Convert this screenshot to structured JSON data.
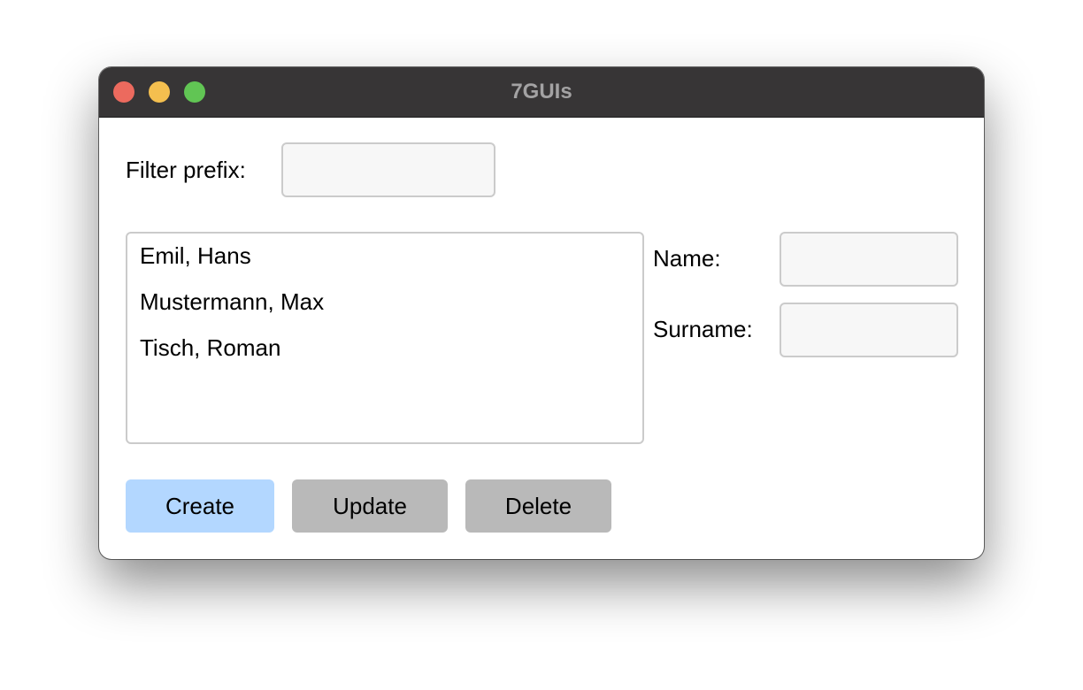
{
  "window": {
    "title": "7GUIs"
  },
  "filter": {
    "label": "Filter prefix:",
    "value": ""
  },
  "list": {
    "items": [
      "Emil, Hans",
      "Mustermann, Max",
      "Tisch, Roman"
    ]
  },
  "form": {
    "name_label": "Name:",
    "name_value": "",
    "surname_label": "Surname:",
    "surname_value": ""
  },
  "buttons": {
    "create_label": "Create",
    "update_label": "Update",
    "delete_label": "Delete"
  },
  "colors": {
    "titlebar": "#373536",
    "close": "#ec6a5e",
    "minimize": "#f4bf4f",
    "maximize": "#61c554",
    "primary_button": "#b3d7ff",
    "secondary_button": "#b9b9b9"
  }
}
